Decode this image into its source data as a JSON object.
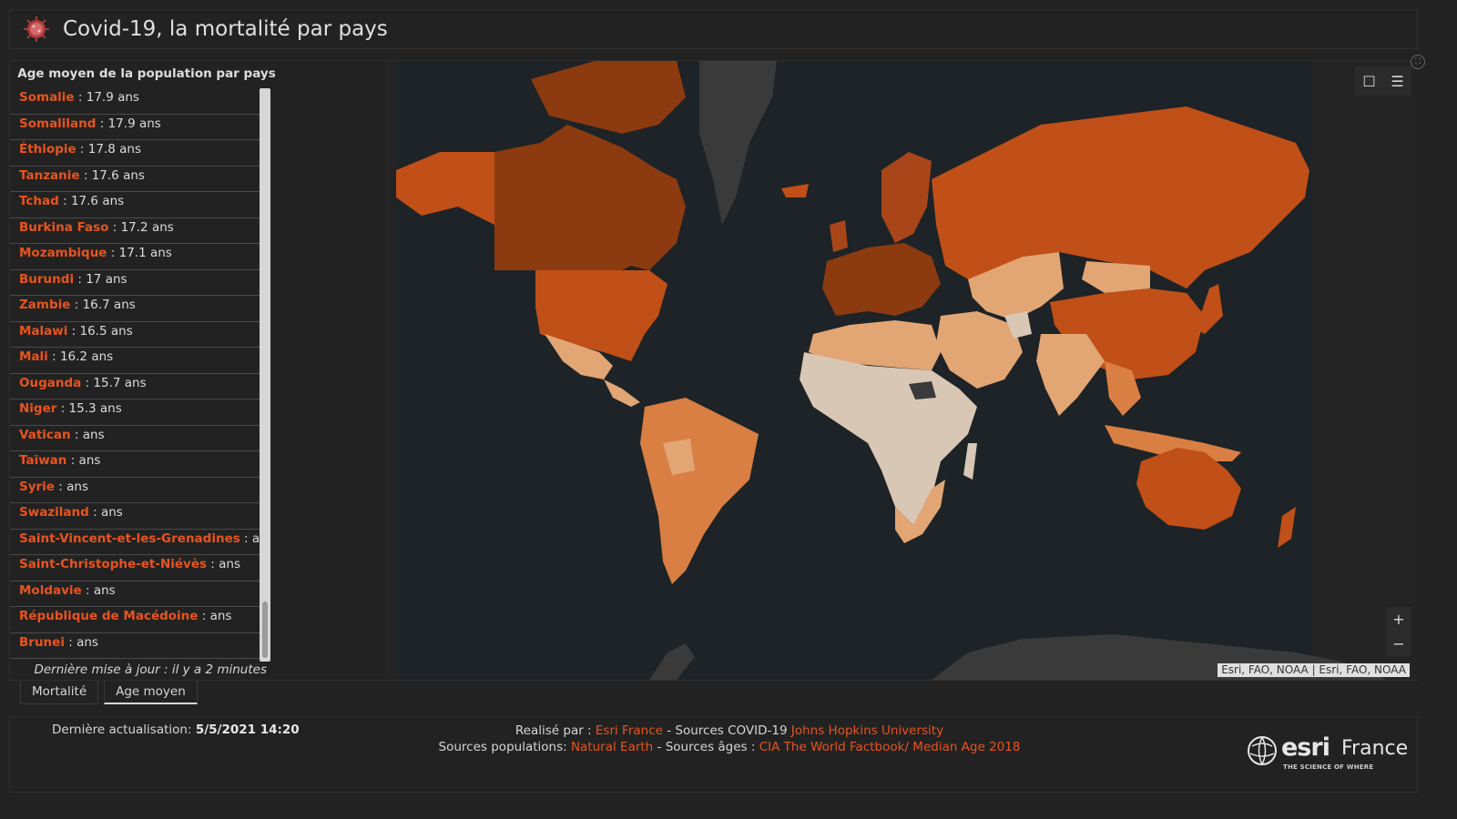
{
  "header": {
    "title": "Covid-19, la mortalité par pays",
    "logo_icon": "virus-icon"
  },
  "list_panel": {
    "title": "Age moyen de la population par pays",
    "unit": "ans",
    "items": [
      {
        "name": "Somalie",
        "value": "17.9"
      },
      {
        "name": "Somaliland",
        "value": "17.9"
      },
      {
        "name": "Éthiopie",
        "value": "17.8"
      },
      {
        "name": "Tanzanie",
        "value": "17.6"
      },
      {
        "name": "Tchad",
        "value": "17.6"
      },
      {
        "name": "Burkina Faso",
        "value": "17.2"
      },
      {
        "name": "Mozambique",
        "value": "17.1"
      },
      {
        "name": "Burundi",
        "value": "17"
      },
      {
        "name": "Zambie",
        "value": "16.7"
      },
      {
        "name": "Malawi",
        "value": "16.5"
      },
      {
        "name": "Mali",
        "value": "16.2"
      },
      {
        "name": "Ouganda",
        "value": "15.7"
      },
      {
        "name": "Niger",
        "value": "15.3"
      },
      {
        "name": "Vatican",
        "value": ""
      },
      {
        "name": "Taïwan",
        "value": ""
      },
      {
        "name": "Syrie",
        "value": ""
      },
      {
        "name": "Swaziland",
        "value": ""
      },
      {
        "name": "Saint-Vincent-et-les-Grenadines",
        "value": ""
      },
      {
        "name": "Saint-Christophe-et-Niévès",
        "value": ""
      },
      {
        "name": "Moldavie",
        "value": ""
      },
      {
        "name": "République de Macédoine",
        "value": ""
      },
      {
        "name": "Brunei",
        "value": ""
      }
    ],
    "last_update": "Dernière mise à jour : il y a 2 minutes"
  },
  "map": {
    "attribution": "Esri, FAO, NOAA | Esri, FAO, NOAA",
    "zoom_in": "+",
    "zoom_out": "−",
    "tools": {
      "bookmark_icon": "bookmark-icon",
      "legend_icon": "list-icon"
    },
    "colors": {
      "ocean": "#242424",
      "land_nodata": "#3a3a3a",
      "very_old": "#8c3a10",
      "old": "#a8461a",
      "mid_high": "#c04f18",
      "mid": "#d97f44",
      "low": "#e2a574",
      "very_young": "#d9c7b6"
    }
  },
  "tabs": [
    {
      "label": "Mortalité",
      "active": false
    },
    {
      "label": "Age moyen",
      "active": true
    }
  ],
  "footer": {
    "last_update_label": "Dernière actualisation:",
    "last_update_value": "5/5/2021 14:20",
    "line1_prefix": "Realisé par : ",
    "line1_link1": "Esri France",
    "line1_mid": " -  Sources COVID-19 ",
    "line1_link2": "Johns Hopkins University",
    "line2_prefix": "Sources populations: ",
    "line2_link1": "Natural Earth",
    "line2_mid": " - Sources âges : ",
    "line2_link2": "CIA The World Factbook/ Median Age 2018",
    "brand_word": "esri",
    "brand_region": "France",
    "brand_tagline": "THE SCIENCE OF WHERE"
  }
}
